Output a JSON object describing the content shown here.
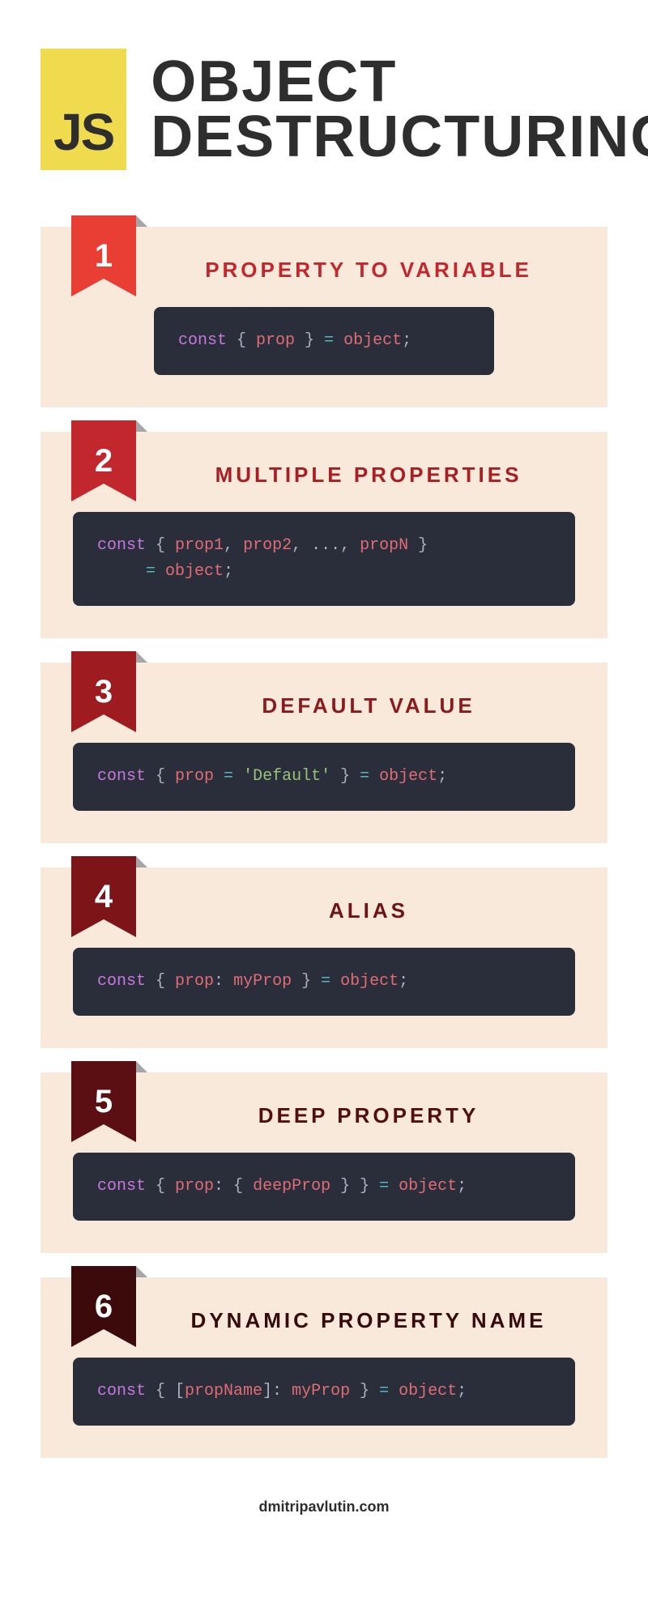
{
  "logo": "JS",
  "title_line1": "OBJECT",
  "title_line2": "DESTRUCTURING",
  "footer": "dmitripavlutin.com",
  "sections": [
    {
      "num": "1",
      "title": "PROPERTY TO VARIABLE",
      "ribbon_bg": "#e83e33",
      "title_color": "#c1272d",
      "code_tokens": [
        {
          "t": "const ",
          "c": "kw"
        },
        {
          "t": "{ ",
          "c": "punct"
        },
        {
          "t": "prop",
          "c": "token"
        },
        {
          "t": " } ",
          "c": "punct"
        },
        {
          "t": "= ",
          "c": "eq"
        },
        {
          "t": "object",
          "c": "token"
        },
        {
          "t": ";",
          "c": "punct"
        }
      ],
      "narrow": true
    },
    {
      "num": "2",
      "title": "MULTIPLE PROPERTIES",
      "ribbon_bg": "#c1272d",
      "title_color": "#a81e22",
      "code_tokens": [
        {
          "t": "const ",
          "c": "kw"
        },
        {
          "t": "{ ",
          "c": "punct"
        },
        {
          "t": "prop1",
          "c": "token"
        },
        {
          "t": ", ",
          "c": "punct"
        },
        {
          "t": "prop2",
          "c": "token"
        },
        {
          "t": ", ",
          "c": "punct"
        },
        {
          "t": "...",
          "c": "punct"
        },
        {
          "t": ", ",
          "c": "punct"
        },
        {
          "t": "propN",
          "c": "token"
        },
        {
          "t": " }",
          "c": "punct"
        },
        {
          "br": true
        },
        {
          "t": "",
          "c": "indent"
        },
        {
          "t": "= ",
          "c": "eq"
        },
        {
          "t": "object",
          "c": "token"
        },
        {
          "t": ";",
          "c": "punct"
        }
      ]
    },
    {
      "num": "3",
      "title": "DEFAULT VALUE",
      "ribbon_bg": "#9e1c20",
      "title_color": "#8a1a1d",
      "code_tokens": [
        {
          "t": "const ",
          "c": "kw"
        },
        {
          "t": "{ ",
          "c": "punct"
        },
        {
          "t": "prop",
          "c": "token"
        },
        {
          "t": " = ",
          "c": "eq"
        },
        {
          "t": "'Default'",
          "c": "str"
        },
        {
          "t": " } ",
          "c": "punct"
        },
        {
          "t": "= ",
          "c": "eq"
        },
        {
          "t": "object",
          "c": "token"
        },
        {
          "t": ";",
          "c": "punct"
        }
      ]
    },
    {
      "num": "4",
      "title": "ALIAS",
      "ribbon_bg": "#7d1518",
      "title_color": "#6e1417",
      "code_tokens": [
        {
          "t": "const ",
          "c": "kw"
        },
        {
          "t": "{ ",
          "c": "punct"
        },
        {
          "t": "prop",
          "c": "token"
        },
        {
          "t": ": ",
          "c": "punct"
        },
        {
          "t": "myProp",
          "c": "token"
        },
        {
          "t": " } ",
          "c": "punct"
        },
        {
          "t": "= ",
          "c": "eq"
        },
        {
          "t": "object",
          "c": "token"
        },
        {
          "t": ";",
          "c": "punct"
        }
      ]
    },
    {
      "num": "5",
      "title": "DEEP PROPERTY",
      "ribbon_bg": "#5c0f12",
      "title_color": "#520e10",
      "code_tokens": [
        {
          "t": "const ",
          "c": "kw"
        },
        {
          "t": "{ ",
          "c": "punct"
        },
        {
          "t": "prop",
          "c": "token"
        },
        {
          "t": ": { ",
          "c": "punct"
        },
        {
          "t": "deepProp",
          "c": "token"
        },
        {
          "t": " } } ",
          "c": "punct"
        },
        {
          "t": "= ",
          "c": "eq"
        },
        {
          "t": "object",
          "c": "token"
        },
        {
          "t": ";",
          "c": "punct"
        }
      ]
    },
    {
      "num": "6",
      "title": "DYNAMIC PROPERTY NAME",
      "ribbon_bg": "#3d0a0c",
      "title_color": "#36090b",
      "code_tokens": [
        {
          "t": "const ",
          "c": "kw"
        },
        {
          "t": "{ [",
          "c": "punct"
        },
        {
          "t": "propName",
          "c": "token"
        },
        {
          "t": "]: ",
          "c": "punct"
        },
        {
          "t": "myProp",
          "c": "token"
        },
        {
          "t": " } ",
          "c": "punct"
        },
        {
          "t": "= ",
          "c": "eq"
        },
        {
          "t": "object",
          "c": "token"
        },
        {
          "t": ";",
          "c": "punct"
        }
      ]
    }
  ]
}
